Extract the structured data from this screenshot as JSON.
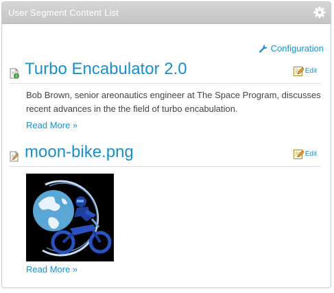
{
  "portlet": {
    "title": "User Segment Content List",
    "options_icon": "gear-icon"
  },
  "toolbar": {
    "configuration_label": "Configuration",
    "configuration_icon": "wrench-icon"
  },
  "entries": [
    {
      "title": "Turbo Encabulator 2.0",
      "type_icon": "web-content-icon",
      "edit_label": "Edit",
      "summary": "Bob Brown, senior areonautics engineer at The Space Program, discusses recent advances in the the field of turbo encabulation.",
      "read_more": "Read More »"
    },
    {
      "title": "moon-bike.png",
      "type_icon": "document-icon",
      "edit_label": "Edit",
      "image": "moon-bike-thumbnail",
      "read_more": "Read More »"
    }
  ],
  "colors": {
    "link": "#1a8fcc",
    "titlebar": "#c8c8c8",
    "text": "#444444"
  }
}
